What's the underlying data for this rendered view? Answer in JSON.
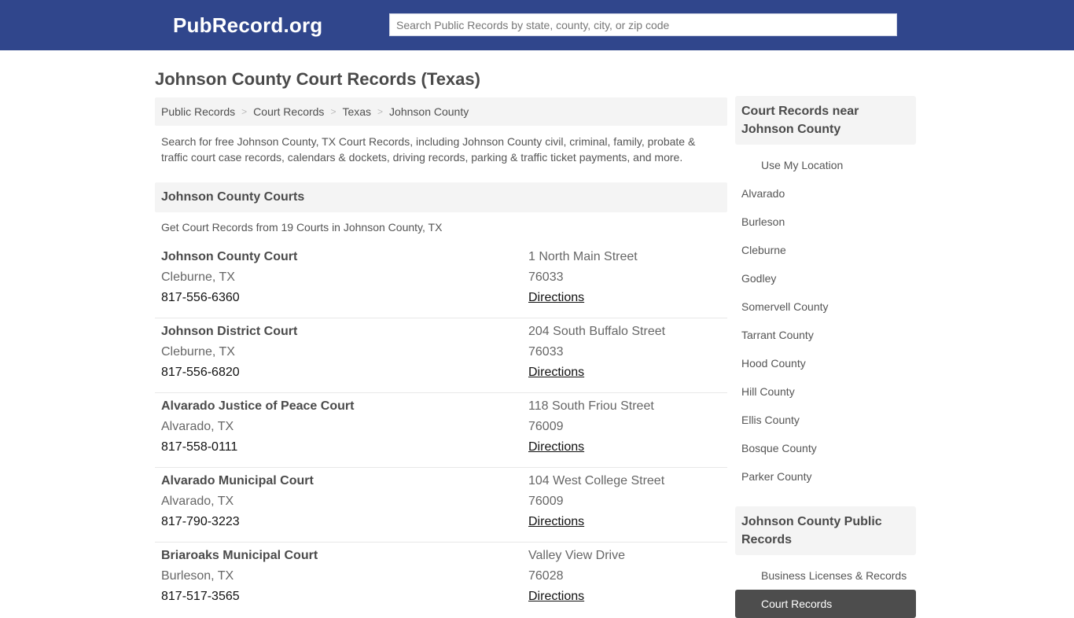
{
  "header": {
    "logo": "PubRecord.org",
    "search_placeholder": "Search Public Records by state, county, city, or zip code",
    "search_value": ""
  },
  "page": {
    "title": "Johnson County Court Records (Texas)",
    "breadcrumb": [
      "Public Records",
      "Court Records",
      "Texas",
      "Johnson County"
    ],
    "breadcrumb_separator": ">",
    "intro": "Search for free Johnson County, TX Court Records, including Johnson County civil, criminal, family, probate & traffic court case records, calendars & dockets, driving records, parking & traffic ticket payments, and more."
  },
  "courts_section": {
    "heading": "Johnson County Courts",
    "subheading": "Get Court Records from 19 Courts in Johnson County, TX",
    "courts": [
      {
        "name": "Johnson County Court",
        "city": "Cleburne, TX",
        "phone": "817-556-6360",
        "street": "1 North Main Street",
        "zip": "76033",
        "directions": "Directions"
      },
      {
        "name": "Johnson District Court",
        "city": "Cleburne, TX",
        "phone": "817-556-6820",
        "street": "204 South Buffalo Street",
        "zip": "76033",
        "directions": "Directions"
      },
      {
        "name": "Alvarado Justice of Peace Court",
        "city": "Alvarado, TX",
        "phone": "817-558-0111",
        "street": "118 South Friou Street",
        "zip": "76009",
        "directions": "Directions"
      },
      {
        "name": "Alvarado Municipal Court",
        "city": "Alvarado, TX",
        "phone": "817-790-3223",
        "street": "104 West College Street",
        "zip": "76009",
        "directions": "Directions"
      },
      {
        "name": "Briaroaks Municipal Court",
        "city": "Burleson, TX",
        "phone": "817-517-3565",
        "street": "Valley View Drive",
        "zip": "76028",
        "directions": "Directions"
      }
    ]
  },
  "sidebar": {
    "nearby": {
      "heading": "Court Records near Johnson County",
      "use_location": "Use My Location",
      "items": [
        "Alvarado",
        "Burleson",
        "Cleburne",
        "Godley",
        "Somervell County",
        "Tarrant County",
        "Hood County",
        "Hill County",
        "Ellis County",
        "Bosque County",
        "Parker County"
      ]
    },
    "public_records": {
      "heading": "Johnson County Public Records",
      "items": [
        {
          "label": "Business Licenses & Records",
          "active": false
        },
        {
          "label": "Court Records",
          "active": true
        }
      ]
    }
  },
  "colors": {
    "header_bg": "#30468c",
    "panel_bg": "#f4f4f4",
    "active_item_bg": "#4d4d4d"
  }
}
